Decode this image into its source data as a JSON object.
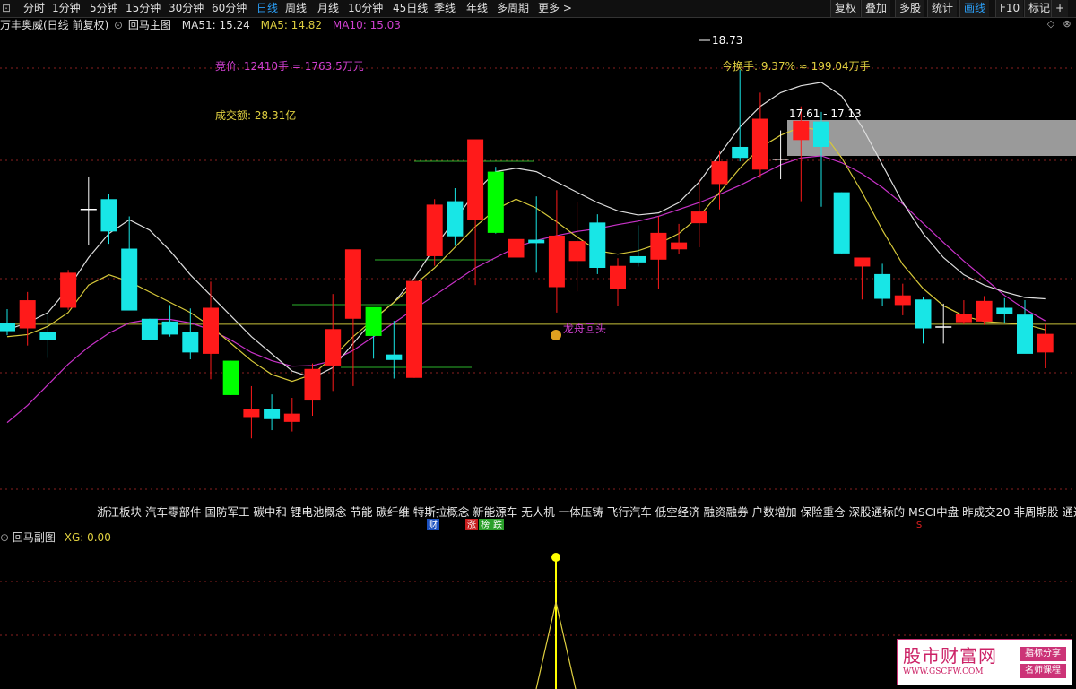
{
  "toolbar": {
    "left_items": [
      {
        "label": "分时",
        "active": false
      },
      {
        "label": "1分钟",
        "active": false
      },
      {
        "label": "5分钟",
        "active": false
      },
      {
        "label": "15分钟",
        "active": false
      },
      {
        "label": "30分钟",
        "active": false
      },
      {
        "label": "60分钟",
        "active": false
      },
      {
        "label": "日线",
        "active": true
      },
      {
        "label": "周线",
        "active": false
      },
      {
        "label": "月线",
        "active": false
      },
      {
        "label": "10分钟",
        "active": false
      },
      {
        "label": "45日线",
        "active": false
      },
      {
        "label": "季线",
        "active": false
      },
      {
        "label": "年线",
        "active": false
      },
      {
        "label": "多周期",
        "active": false
      },
      {
        "label": "更多",
        "active": false
      }
    ],
    "right_items": [
      {
        "label": "复权",
        "active": false
      },
      {
        "label": "叠加",
        "active": false
      },
      {
        "label": "多股",
        "active": false
      },
      {
        "label": "统计",
        "active": false
      },
      {
        "label": "画线",
        "active": true
      },
      {
        "label": "F10",
        "active": false
      },
      {
        "label": "标记",
        "active": false
      },
      {
        "label": "+",
        "active": false
      }
    ]
  },
  "info_bar": {
    "stock": "万丰奥威(日线 前复权)",
    "indicator": "回马主图",
    "ma51": "MA51: 15.24",
    "ma5": "MA5: 14.82",
    "ma10": "MA10: 15.03"
  },
  "sub_bar": {
    "indicator": "回马副图",
    "xg": "XG: 0.00"
  },
  "colors": {
    "up": "#ff1a1a",
    "down": "#18e6e6",
    "green": "#00ff00",
    "white_line": "#dddddd",
    "yellow_line": "#d6c83a",
    "magenta_line": "#c832c8",
    "horizontal_line": "#c9c33a",
    "gray_box": "#9a9a9a",
    "grid": "#8a2020"
  },
  "chart_data": {
    "type": "candlestick",
    "price_range": [
      12.5,
      19.2
    ],
    "grid": true,
    "candles": [
      {
        "o": 15.05,
        "h": 15.25,
        "l": 14.87,
        "c": 14.93,
        "color": "down"
      },
      {
        "o": 14.97,
        "h": 15.5,
        "l": 14.72,
        "c": 15.38,
        "color": "up"
      },
      {
        "o": 14.8,
        "h": 15.2,
        "l": 14.54,
        "c": 14.92,
        "color": "down"
      },
      {
        "o": 15.27,
        "h": 15.82,
        "l": 15.24,
        "c": 15.78,
        "color": "up"
      },
      {
        "o": 16.7,
        "h": 17.18,
        "l": 16.18,
        "c": 16.7,
        "color": "doji"
      },
      {
        "o": 16.85,
        "h": 16.93,
        "l": 16.2,
        "c": 16.38,
        "color": "down"
      },
      {
        "o": 16.13,
        "h": 16.6,
        "l": 15.24,
        "c": 15.23,
        "color": "down"
      },
      {
        "o": 15.11,
        "h": 15.11,
        "l": 14.8,
        "c": 14.8,
        "color": "down"
      },
      {
        "o": 15.07,
        "h": 15.31,
        "l": 14.85,
        "c": 14.88,
        "color": "down"
      },
      {
        "o": 14.92,
        "h": 15.26,
        "l": 14.52,
        "c": 14.62,
        "color": "down"
      },
      {
        "o": 14.6,
        "h": 15.65,
        "l": 14.23,
        "c": 15.27,
        "color": "up"
      },
      {
        "o": 14.5,
        "h": 14.5,
        "l": 14.0,
        "c": 14.0,
        "color": "green"
      },
      {
        "o": 13.68,
        "h": 14.13,
        "l": 13.37,
        "c": 13.8,
        "color": "up"
      },
      {
        "o": 13.8,
        "h": 14.01,
        "l": 13.49,
        "c": 13.65,
        "color": "down"
      },
      {
        "o": 13.61,
        "h": 13.96,
        "l": 13.47,
        "c": 13.73,
        "color": "up"
      },
      {
        "o": 13.92,
        "h": 14.46,
        "l": 13.7,
        "c": 14.38,
        "color": "up"
      },
      {
        "o": 14.43,
        "h": 15.47,
        "l": 14.06,
        "c": 14.96,
        "color": "up"
      },
      {
        "o": 15.11,
        "h": 15.72,
        "l": 14.13,
        "c": 16.12,
        "color": "up"
      },
      {
        "o": 14.86,
        "h": 15.2,
        "l": 14.53,
        "c": 15.28,
        "color": "green"
      },
      {
        "o": 14.59,
        "h": 15.08,
        "l": 14.24,
        "c": 14.51,
        "color": "down"
      },
      {
        "o": 14.25,
        "h": 15.66,
        "l": 14.25,
        "c": 15.66,
        "color": "up"
      },
      {
        "o": 16.02,
        "h": 16.85,
        "l": 15.88,
        "c": 16.77,
        "color": "up"
      },
      {
        "o": 16.31,
        "h": 17.01,
        "l": 16.17,
        "c": 16.82,
        "color": "down"
      },
      {
        "o": 16.55,
        "h": 16.7,
        "l": 15.6,
        "c": 17.72,
        "color": "up"
      },
      {
        "o": 16.36,
        "h": 17.32,
        "l": 16.35,
        "c": 17.25,
        "color": "green"
      },
      {
        "o": 16.27,
        "h": 16.68,
        "l": 16.04,
        "c": 16.0,
        "color": "up"
      },
      {
        "o": 16.26,
        "h": 16.89,
        "l": 15.78,
        "c": 16.21,
        "color": "down"
      },
      {
        "o": 15.57,
        "h": 16.98,
        "l": 15.2,
        "c": 16.32,
        "color": "up"
      },
      {
        "o": 16.24,
        "h": 16.81,
        "l": 15.51,
        "c": 15.95,
        "color": "up"
      },
      {
        "o": 16.51,
        "h": 16.63,
        "l": 15.76,
        "c": 15.85,
        "color": "down"
      },
      {
        "o": 15.55,
        "h": 15.99,
        "l": 15.29,
        "c": 15.88,
        "color": "up"
      },
      {
        "o": 15.93,
        "h": 16.47,
        "l": 15.87,
        "c": 16.02,
        "color": "down"
      },
      {
        "o": 15.97,
        "h": 16.6,
        "l": 15.54,
        "c": 16.36,
        "color": "up"
      },
      {
        "o": 16.12,
        "h": 16.49,
        "l": 16.05,
        "c": 16.22,
        "color": "up"
      },
      {
        "o": 16.5,
        "h": 17.14,
        "l": 16.15,
        "c": 16.67,
        "color": "up"
      },
      {
        "o": 17.07,
        "h": 17.56,
        "l": 16.7,
        "c": 17.4,
        "color": "up"
      },
      {
        "o": 17.61,
        "h": 18.73,
        "l": 17.4,
        "c": 17.45,
        "color": "down"
      },
      {
        "o": 17.28,
        "h": 18.4,
        "l": 17.16,
        "c": 18.02,
        "color": "up"
      },
      {
        "o": 17.3,
        "h": 17.85,
        "l": 17.14,
        "c": 17.43,
        "color": "doji"
      },
      {
        "o": 17.71,
        "h": 18.2,
        "l": 16.82,
        "c": 17.99,
        "color": "up"
      },
      {
        "o": 17.98,
        "h": 18.12,
        "l": 16.74,
        "c": 17.61,
        "color": "down"
      },
      {
        "o": 16.95,
        "h": 16.95,
        "l": 16.06,
        "c": 16.06,
        "color": "down"
      },
      {
        "o": 16.0,
        "h": 16.0,
        "l": 15.39,
        "c": 15.87,
        "color": "up"
      },
      {
        "o": 15.76,
        "h": 15.91,
        "l": 15.3,
        "c": 15.4,
        "color": "down"
      },
      {
        "o": 15.45,
        "h": 15.62,
        "l": 15.16,
        "c": 15.31,
        "color": "up"
      },
      {
        "o": 15.39,
        "h": 15.43,
        "l": 14.75,
        "c": 14.97,
        "color": "down"
      },
      {
        "o": 14.99,
        "h": 15.33,
        "l": 14.75,
        "c": 14.98,
        "color": "doji"
      },
      {
        "o": 15.06,
        "h": 15.38,
        "l": 15.03,
        "c": 15.18,
        "color": "up"
      },
      {
        "o": 15.07,
        "h": 15.44,
        "l": 15.02,
        "c": 15.37,
        "color": "up"
      },
      {
        "o": 15.27,
        "h": 15.41,
        "l": 15.04,
        "c": 15.18,
        "color": "down"
      },
      {
        "o": 15.17,
        "h": 15.38,
        "l": 14.63,
        "c": 14.6,
        "color": "down"
      },
      {
        "o": 14.62,
        "h": 15.03,
        "l": 14.39,
        "c": 14.89,
        "color": "up"
      }
    ],
    "ma_white": [
      14.95,
      15.05,
      15.2,
      15.55,
      16.0,
      16.35,
      16.55,
      16.4,
      16.1,
      15.75,
      15.45,
      15.15,
      14.85,
      14.6,
      14.35,
      14.25,
      14.4,
      14.75,
      15.1,
      15.35,
      15.7,
      16.15,
      16.55,
      16.95,
      17.25,
      17.3,
      17.25,
      17.1,
      16.95,
      16.8,
      16.68,
      16.62,
      16.65,
      16.8,
      17.1,
      17.5,
      17.9,
      18.2,
      18.4,
      18.5,
      18.55,
      18.35,
      17.9,
      17.35,
      16.8,
      16.35,
      16.0,
      15.75,
      15.6,
      15.5,
      15.42,
      15.4
    ],
    "ma_yellow": [
      14.85,
      14.88,
      15.0,
      15.2,
      15.6,
      15.75,
      15.65,
      15.5,
      15.35,
      15.2,
      15.0,
      14.75,
      14.5,
      14.3,
      14.2,
      14.3,
      14.55,
      14.85,
      15.1,
      15.35,
      15.6,
      15.85,
      16.15,
      16.45,
      16.7,
      16.85,
      16.72,
      16.52,
      16.3,
      16.1,
      16.05,
      16.1,
      16.2,
      16.35,
      16.6,
      16.95,
      17.3,
      17.6,
      17.78,
      17.9,
      17.85,
      17.45,
      16.95,
      16.4,
      15.9,
      15.55,
      15.3,
      15.15,
      15.07,
      15.05,
      15.03,
      14.95
    ],
    "ma_magenta": [
      13.6,
      13.85,
      14.15,
      14.45,
      14.7,
      14.9,
      15.05,
      15.1,
      15.1,
      15.05,
      14.95,
      14.8,
      14.62,
      14.5,
      14.42,
      14.43,
      14.5,
      14.65,
      14.85,
      15.05,
      15.25,
      15.45,
      15.65,
      15.85,
      16.0,
      16.15,
      16.25,
      16.32,
      16.38,
      16.42,
      16.48,
      16.53,
      16.6,
      16.7,
      16.8,
      16.92,
      17.05,
      17.2,
      17.35,
      17.45,
      17.48,
      17.38,
      17.22,
      17.02,
      16.78,
      16.5,
      16.22,
      15.95,
      15.7,
      15.45,
      15.25,
      15.08
    ],
    "horizontal_line_price": 15.03,
    "annotations": {
      "bid": "竞价: 12410手 = 1763.5万元",
      "turnover": "成交额: 28.31亿",
      "turnover_rate": "今换手: 9.37% ≈ 199.04万手",
      "high_label": "18.73",
      "range_label": "17.61 - 17.13",
      "dragon": "龙舟回头",
      "fund_badge": "财",
      "limit_badge": "涨",
      "rank_badge": "榜",
      "drop_badge": "跌",
      "s_badge": "S"
    },
    "concepts": "浙江板块 汽车零部件 国防军工 碳中和 锂电池概念 节能 碳纤维 特斯拉概念 新能源车 无人机 一体压铸 飞行汽车 低空经济 融资融券 户数增加 保险重仓 深股通标的 MSCI中盘 昨成交20 非周期股 通达信",
    "sub_signal_peak": 1.0
  }
}
